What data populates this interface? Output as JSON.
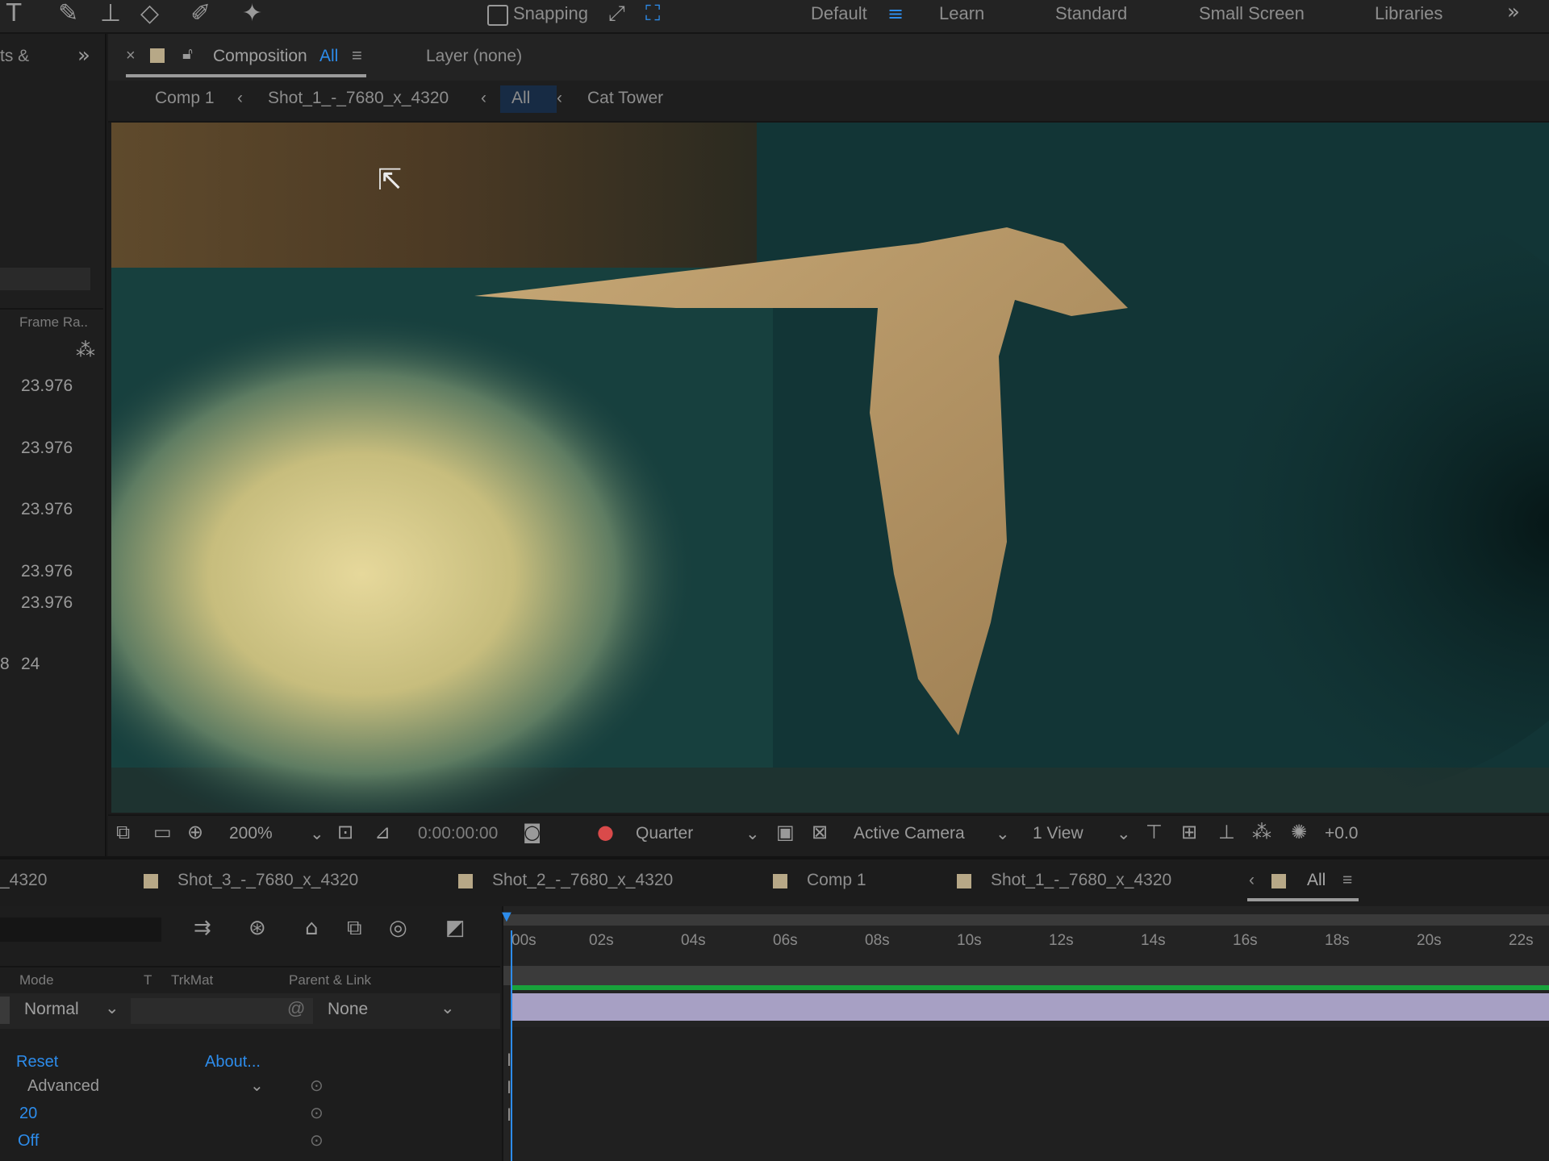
{
  "toolbar": {
    "snapping_label": "Snapping",
    "workspaces": [
      "Default",
      "Learn",
      "Standard",
      "Small Screen",
      "Libraries"
    ]
  },
  "left_panel": {
    "tab_label": "ts &",
    "column_header": "Frame Ra..",
    "frame_rates": [
      "23.976",
      "23.976",
      "23.976",
      "23.976",
      "23.976",
      "24"
    ],
    "extra_value": "8"
  },
  "composition": {
    "tab_label": "Composition",
    "tab_name": "All",
    "layer_tab": "Layer (none)",
    "breadcrumbs": [
      "Comp 1",
      "Shot_1_-_7680_x_4320",
      "All",
      "Cat Tower"
    ]
  },
  "viewer_toolbar": {
    "zoom": "200%",
    "timecode": "0:00:00:00",
    "resolution": "Quarter",
    "camera": "Active Camera",
    "views": "1 View",
    "exposure": "+0.0"
  },
  "timeline": {
    "tabs": [
      "_4320",
      "Shot_3_-_7680_x_4320",
      "Shot_2_-_7680_x_4320",
      "Comp 1",
      "Shot_1_-_7680_x_4320",
      "All"
    ],
    "ruler": [
      "00s",
      "02s",
      "04s",
      "06s",
      "08s",
      "10s",
      "12s",
      "14s",
      "16s",
      "18s",
      "20s",
      "22s"
    ],
    "headers": {
      "mode": "Mode",
      "t": "T",
      "trkmat": "TrkMat",
      "parent": "Parent & Link"
    },
    "layer": {
      "mode": "Normal",
      "parent": "None"
    },
    "effects": {
      "reset": "Reset",
      "about": "About...",
      "preset": "Advanced",
      "value1": "20",
      "value2": "Off"
    }
  },
  "colors": {
    "accent": "#2d8ceb",
    "label_swatch": "#b7a887",
    "layer_bar": "#a7a0c4",
    "work_area": "#18a23b"
  }
}
